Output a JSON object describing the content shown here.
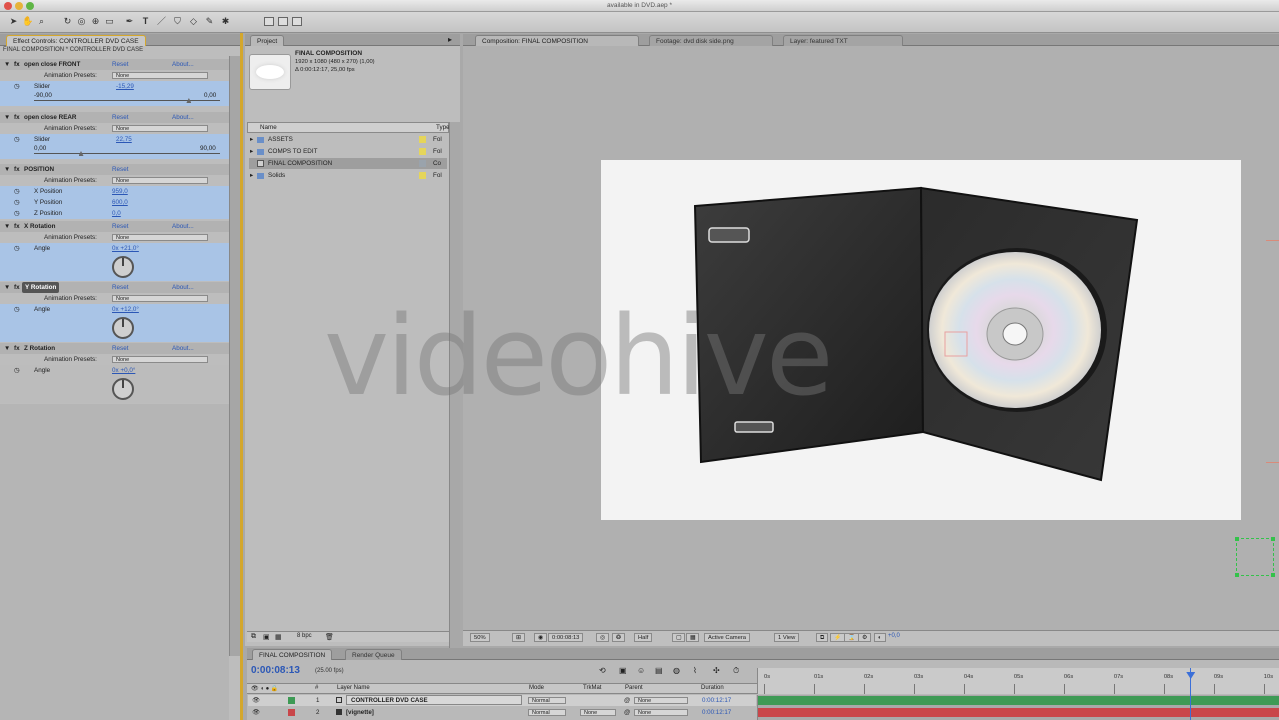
{
  "window": {
    "title": "available in DVD.aep *"
  },
  "colors": {
    "accent_blue": "#2b57b6",
    "selection": "#a9c4e6",
    "track_green": "#3e9a55",
    "track_red": "#c9464a",
    "guide_green": "#33c24a",
    "playhead": "#3b6fd8"
  },
  "effect_controls": {
    "tab": "Effect Controls: CONTROLLER DVD CASE",
    "breadcrumb": "FINAL COMPOSITION * CONTROLLER DVD CASE",
    "reset": "Reset",
    "about": "About...",
    "presets_label": "Animation Presets:",
    "presets_value": "None",
    "groups": [
      {
        "name": "open close FRONT",
        "prop": "Slider",
        "value": "-15,29",
        "min": "-90,00",
        "max": "0,00",
        "fraction": 0.83
      },
      {
        "name": "open close REAR",
        "prop": "Slider",
        "value": "22,75",
        "min": "0,00",
        "max": "90,00",
        "fraction": 0.25
      }
    ],
    "position": {
      "name": "POSITION",
      "rows": [
        {
          "label": "X Position",
          "value": "959,0"
        },
        {
          "label": "Y Position",
          "value": "600,0"
        },
        {
          "label": "Z Position",
          "value": "0,0"
        }
      ]
    },
    "rotations": [
      {
        "name": "X Rotation",
        "prop": "Angle",
        "value": "0x +21,0°"
      },
      {
        "name": "Y Rotation",
        "prop": "Angle",
        "value": "0x +12,0°"
      },
      {
        "name": "Z Rotation",
        "prop": "Angle",
        "value": "0x +0,0°"
      }
    ]
  },
  "project": {
    "tab": "Project",
    "comp_name": "FINAL COMPOSITION",
    "comp_info1": "1920 x 1080 (480 x 270) (1,00)",
    "comp_info2": "Δ 0:00:12:17, 25,00 fps",
    "col_name": "Name",
    "col_type": "Type",
    "items": [
      {
        "name": "ASSETS",
        "type": "Fol"
      },
      {
        "name": "COMPS TO EDIT",
        "type": "Fol"
      },
      {
        "name": "FINAL COMPOSITION",
        "type": "Co"
      },
      {
        "name": "Solids",
        "type": "Fol"
      }
    ],
    "bpc": "8 bpc"
  },
  "composition": {
    "tabs": [
      "Composition: FINAL COMPOSITION",
      "Footage: dvd disk side.png",
      "Layer: featured TXT"
    ],
    "watermark": "videohive",
    "zoom": "50%",
    "timecode": "0:00:08:13",
    "resolution": "Half",
    "camera": "Active Camera",
    "view": "1 View",
    "exposure": "+0,0"
  },
  "timeline": {
    "tabs": [
      "FINAL COMPOSITION",
      "Render Queue"
    ],
    "timecode": "0:00:08:13",
    "fps": "(25.00 fps)",
    "headers": {
      "num": "#",
      "layer": "Layer Name",
      "mode": "Mode",
      "trkmat": "TrkMat",
      "parent": "Parent",
      "duration": "Duration"
    },
    "layers": [
      {
        "num": "1",
        "name": "CONTROLLER DVD CASE",
        "mode": "Normal",
        "trkmat": "",
        "parent": "None",
        "duration": "0:00:12:17"
      },
      {
        "num": "2",
        "name": "[vignette]",
        "mode": "Normal",
        "trkmat": "None",
        "parent": "None",
        "duration": "0:00:12:17"
      }
    ],
    "ruler": [
      "0s",
      "01s",
      "02s",
      "03s",
      "04s",
      "05s",
      "06s",
      "07s",
      "08s",
      "09s",
      "10s"
    ],
    "playhead_fraction": 0.83
  }
}
